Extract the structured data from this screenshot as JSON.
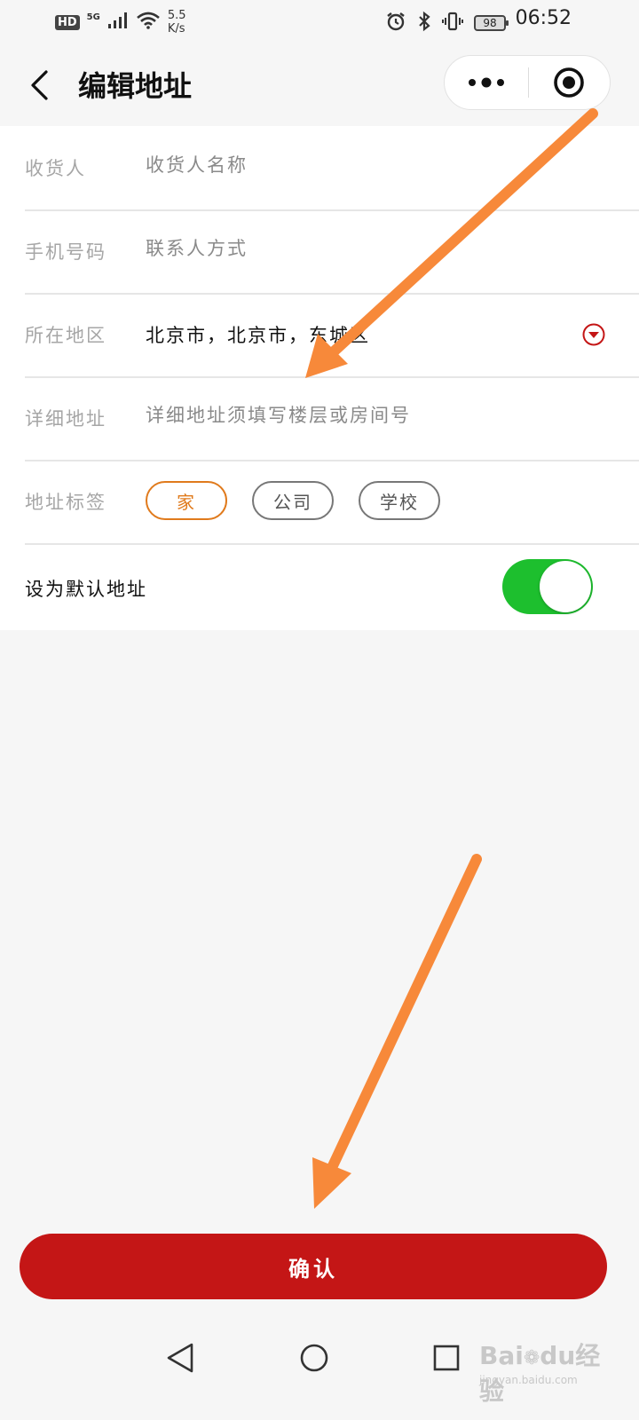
{
  "status_bar": {
    "hd": "HD",
    "network": "5G",
    "speed_value": "5.5",
    "speed_unit": "K/s",
    "battery": "98",
    "time": "06:52"
  },
  "header": {
    "title": "编辑地址",
    "back_icon": "chevron-left-icon",
    "more_icon": "more-dots-icon",
    "close_icon": "target-circle-icon"
  },
  "form": {
    "receiver": {
      "label": "收货人",
      "placeholder": "收货人名称"
    },
    "phone": {
      "label": "手机号码",
      "placeholder": "联系人方式"
    },
    "region": {
      "label": "所在地区",
      "value": "北京市，北京市，东城区"
    },
    "detail": {
      "label": "详细地址",
      "placeholder": "详细地址须填写楼层或房间号"
    },
    "tags": {
      "label": "地址标签",
      "items": [
        {
          "label": "家",
          "selected": true
        },
        {
          "label": "公司",
          "selected": false
        },
        {
          "label": "学校",
          "selected": false
        }
      ]
    },
    "default": {
      "label": "设为默认地址",
      "enabled": true
    }
  },
  "confirm": {
    "label": "确认"
  },
  "watermark": {
    "brand": "Bai",
    "brand_cn": "经验",
    "url": "jingyan.baidu.com"
  },
  "colors": {
    "primary_red": "#c41616",
    "tag_orange": "#e07a1c",
    "toggle_green": "#1dbf2e",
    "annotation_orange": "#f7893a"
  }
}
